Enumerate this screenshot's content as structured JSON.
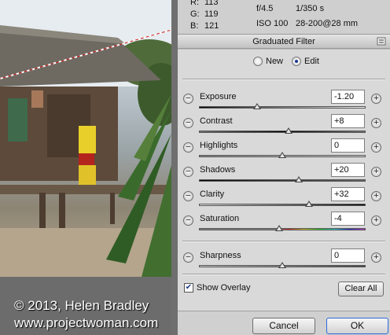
{
  "watermark": {
    "line1": "© 2013, Helen Bradley",
    "line2": "www.projectwoman.com"
  },
  "info": {
    "r_label": "R:",
    "r_value": "113",
    "g_label": "G:",
    "g_value": "119",
    "b_label": "B:",
    "b_value": "121",
    "aperture": "f/4.5",
    "shutter": "1/350 s",
    "iso": "ISO 100",
    "lens": "28-200@28 mm"
  },
  "panel": {
    "title": "Graduated Filter",
    "mode_new": "New",
    "mode_edit": "Edit",
    "selected_mode": "Edit"
  },
  "sliders": [
    {
      "label": "Exposure",
      "value": "-1.20",
      "position": 0.35
    },
    {
      "label": "Contrast",
      "value": "+8",
      "position": 0.54
    },
    {
      "label": "Highlights",
      "value": "0",
      "position": 0.5
    },
    {
      "label": "Shadows",
      "value": "+20",
      "position": 0.6
    },
    {
      "label": "Clarity",
      "value": "+32",
      "position": 0.66
    },
    {
      "label": "Saturation",
      "value": "-4",
      "position": 0.48
    },
    {
      "label": "Sharpness",
      "value": "0",
      "position": 0.5
    }
  ],
  "overlay": {
    "label": "Show Overlay",
    "checked": true
  },
  "buttons": {
    "clear_all": "Clear All",
    "cancel": "Cancel",
    "ok": "OK"
  },
  "colors": {
    "panel_bg": "#d9d9d9",
    "ok_border": "#2f6bd6",
    "radio_selected": "#1e3b8f"
  }
}
